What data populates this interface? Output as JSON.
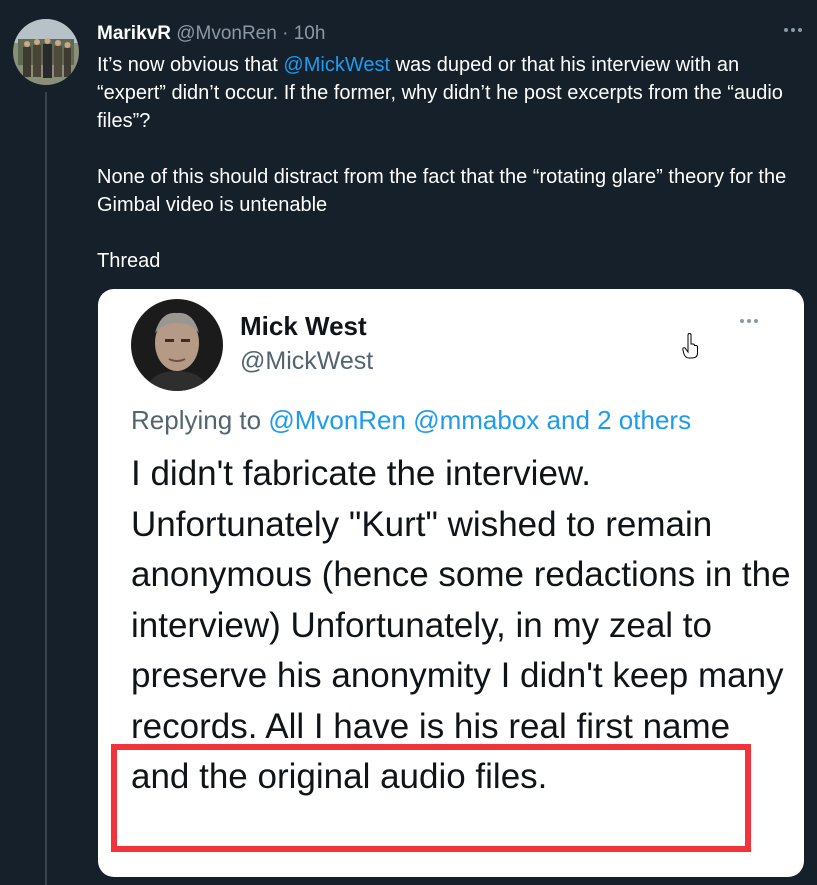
{
  "tweet": {
    "display_name": "MarikvR",
    "handle": "@MvonRen",
    "separator": "·",
    "time": "10h",
    "text_part1": "It’s now obvious that ",
    "mention": "@MickWest",
    "text_part2": " was duped or that his interview with an “expert” didn’t occur. If the former, why didn’t he post excerpts from the “audio files”?",
    "paragraph2": "None of this should distract from the fact that the “rotating glare” theory for the Gimbal video is untenable",
    "paragraph3": "Thread"
  },
  "quoted": {
    "display_name": "Mick West",
    "handle": "@MickWest",
    "replying_prefix": "Replying to ",
    "replying_mentions": "@MvonRen @mmabox and 2 others",
    "body": "I didn't fabricate the interview. Unfortunately \"Kurt\" wished to remain anonymous (hence some redactions in the interview) Unfortunately, in my zeal to preserve his anonymity I didn't keep many records. All I have is his real first name and the original audio files."
  },
  "colors": {
    "background": "#15202b",
    "accent": "#1d9bf0",
    "highlight_box": "#f2333a",
    "muted": "#8b98a5"
  },
  "icons": [
    "more-icon",
    "hand-cursor-icon"
  ]
}
